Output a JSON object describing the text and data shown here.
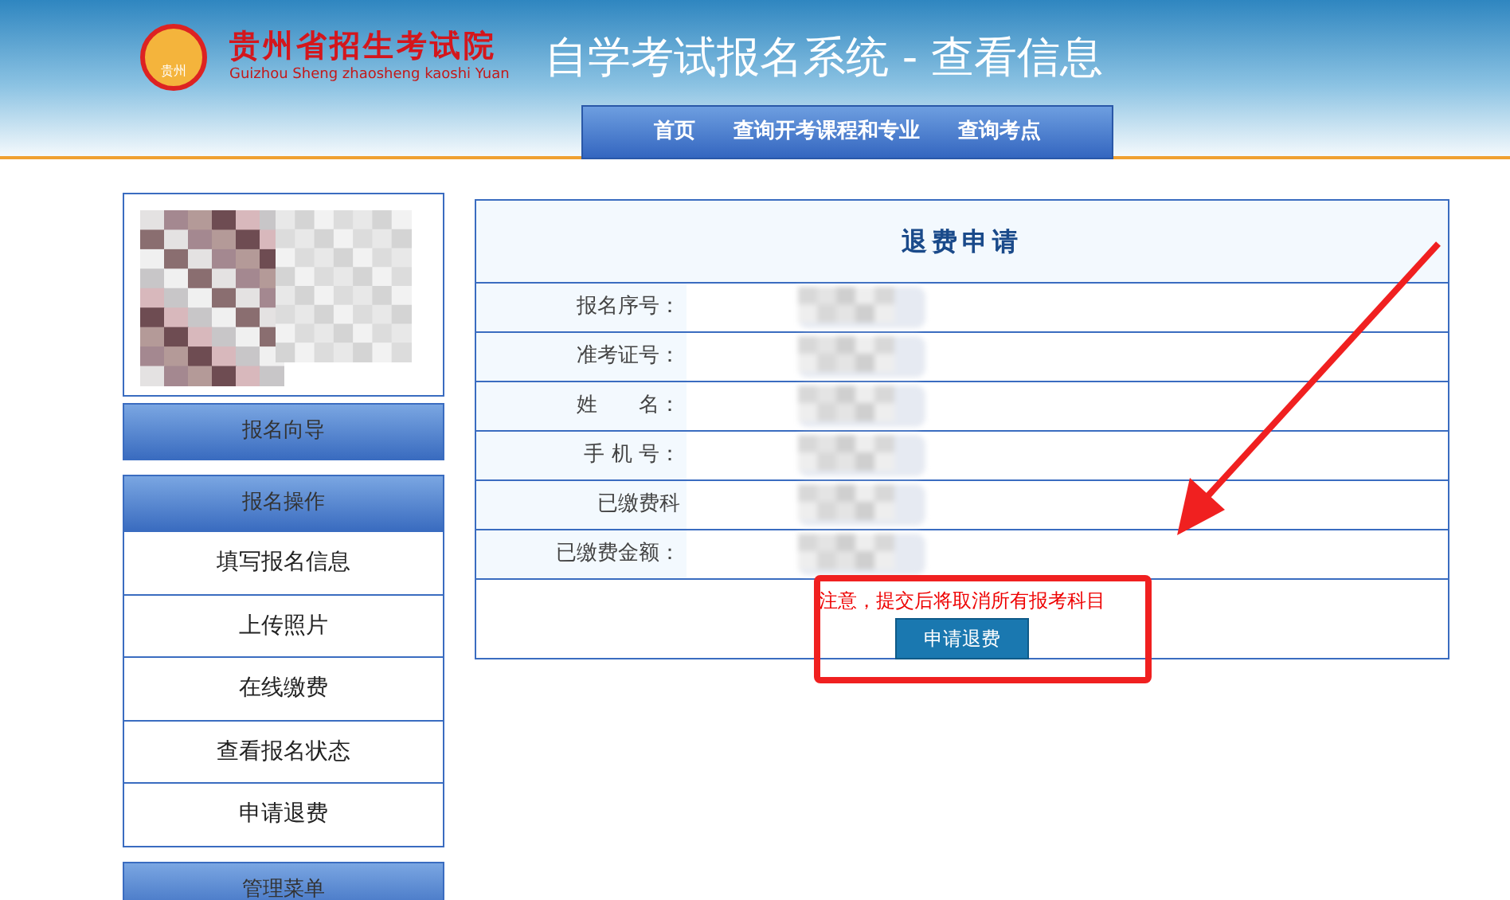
{
  "header": {
    "logo_name": "贵州省招生考试院",
    "logo_subtitle": "Guizhou Sheng zhaosheng kaoshi Yuan",
    "logo_badge": "贵州",
    "title": "自学考试报名系统 - 查看信息"
  },
  "nav": [
    {
      "label": "首页"
    },
    {
      "label": "查询开考课程和专业"
    },
    {
      "label": "查询考点"
    }
  ],
  "sidebar": {
    "photo": {
      "kind": "picture",
      "redacted": true
    },
    "guide_button": "报名向导",
    "operations": {
      "title": "报名操作",
      "items": [
        {
          "label": "填写报名信息"
        },
        {
          "label": "上传照片"
        },
        {
          "label": "在线缴费"
        },
        {
          "label": "查看报名状态"
        },
        {
          "label": "申请退费"
        }
      ]
    },
    "admin_title": "管理菜单"
  },
  "form": {
    "title": "退费申请",
    "rows": [
      {
        "label": "报名序号：",
        "redacted": true
      },
      {
        "label": "准考证号：",
        "redacted": true
      },
      {
        "label": "姓　　名：",
        "redacted": true
      },
      {
        "label": "手 机 号：",
        "redacted": true
      },
      {
        "label": "已缴费科",
        "redacted": true
      },
      {
        "label": "已缴费金额：",
        "redacted": true
      }
    ],
    "notice": "注意，提交后将取消所有报考科目",
    "submit": "申请退费"
  },
  "annotation": {
    "arrow": true,
    "box": true
  }
}
